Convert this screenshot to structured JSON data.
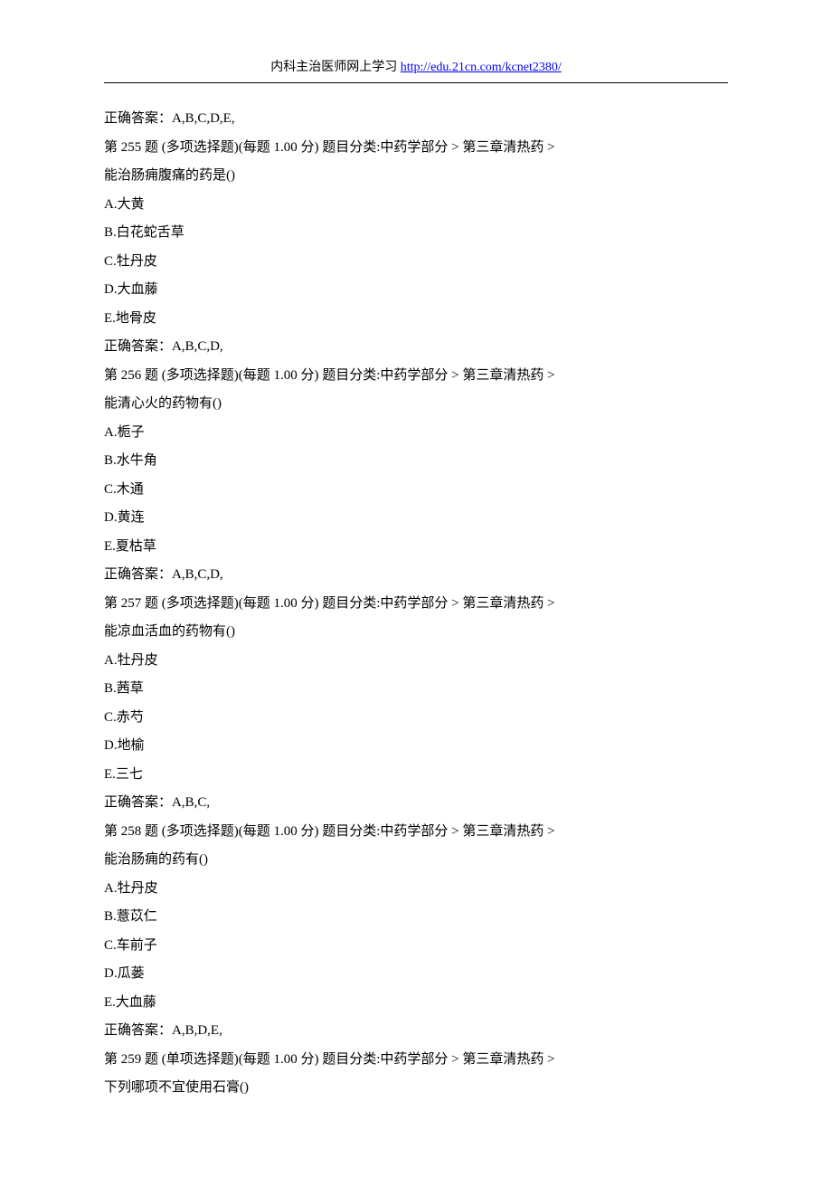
{
  "header": {
    "text": "内科主治医师网上学习",
    "link_text": "http://edu.21cn.com/kcnet2380/"
  },
  "lines": [
    "正确答案：A,B,C,D,E,",
    "第 255 题 (多项选择题)(每题 1.00 分) 题目分类:中药学部分 > 第三章清热药 >",
    "能治肠痈腹痛的药是()",
    "A.大黄",
    "B.白花蛇舌草",
    "C.牡丹皮",
    "D.大血藤",
    "E.地骨皮",
    "正确答案：A,B,C,D,",
    "第 256 题 (多项选择题)(每题 1.00 分) 题目分类:中药学部分 > 第三章清热药 >",
    "能清心火的药物有()",
    "A.栀子",
    "B.水牛角",
    "C.木通",
    "D.黄连",
    "E.夏枯草",
    "正确答案：A,B,C,D,",
    "第 257 题 (多项选择题)(每题 1.00 分) 题目分类:中药学部分 > 第三章清热药 >",
    "能凉血活血的药物有()",
    "A.牡丹皮",
    "B.茜草",
    "C.赤芍",
    "D.地榆",
    "E.三七",
    "正确答案：A,B,C,",
    "第 258 题 (多项选择题)(每题 1.00 分) 题目分类:中药学部分 > 第三章清热药 >",
    "能治肠痈的药有()",
    "A.牡丹皮",
    "B.薏苡仁",
    "C.车前子",
    "D.瓜蒌",
    "E.大血藤",
    "正确答案：A,B,D,E,",
    "第 259 题 (单项选择题)(每题 1.00 分) 题目分类:中药学部分 > 第三章清热药 >",
    "下列哪项不宜使用石膏()"
  ]
}
